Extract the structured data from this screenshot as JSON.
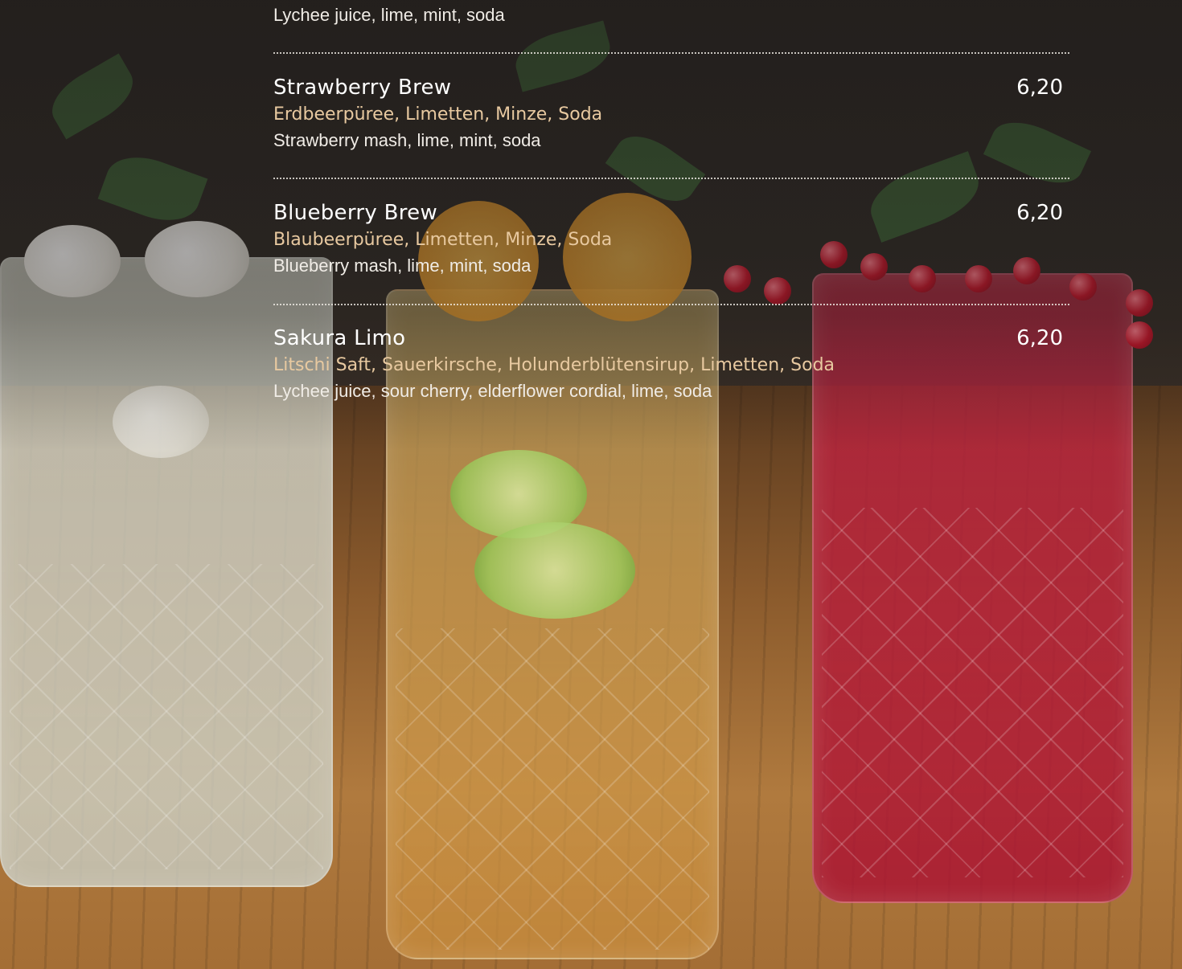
{
  "colors": {
    "name": "#ffffff",
    "german_ingredients": "#e8c9a0",
    "english_ingredients": "#f0ece6"
  },
  "partial_top_item": {
    "english": "Lychee juice, lime, mint, soda"
  },
  "items": [
    {
      "name": "Strawberry Brew",
      "price": "6,20",
      "german": "Erdbeerpüree, Limetten, Minze, Soda",
      "english": "Strawberry mash, lime, mint, soda"
    },
    {
      "name": "Blueberry Brew",
      "price": "6,20",
      "german": "Blaubeerpüree, Limetten, Minze, Soda",
      "english": "Blueberry mash, lime, mint, soda"
    },
    {
      "name": "Sakura Limo",
      "price": "6,20",
      "german": "Litschi Saft, Sauerkirsche, Holunderblütensirup, Limetten, Soda",
      "english": "Lychee juice, sour cherry, elderflower cordial, lime, soda"
    }
  ]
}
